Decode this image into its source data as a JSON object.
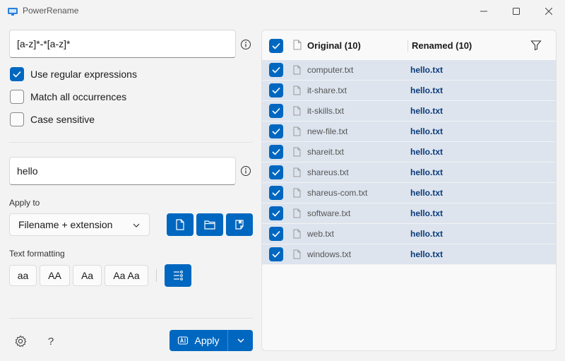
{
  "window": {
    "title": "PowerRename"
  },
  "search": {
    "value": "[a-z]*-*[a-z]*"
  },
  "options": [
    {
      "label": "Use regular expressions",
      "checked": true
    },
    {
      "label": "Match all occurrences",
      "checked": false
    },
    {
      "label": "Case sensitive",
      "checked": false
    }
  ],
  "replace": {
    "value": "hello"
  },
  "apply_to": {
    "label": "Apply to",
    "selected": "Filename + extension"
  },
  "text_formatting": {
    "label": "Text formatting",
    "buttons": [
      "aa",
      "AA",
      "Aa",
      "Aa Aa"
    ]
  },
  "apply_button": {
    "label": "Apply"
  },
  "list": {
    "header_original": "Original (10)",
    "header_renamed": "Renamed (10)",
    "rows": [
      {
        "original": "computer.txt",
        "renamed": "hello.txt"
      },
      {
        "original": "it-share.txt",
        "renamed": "hello.txt"
      },
      {
        "original": "it-skills.txt",
        "renamed": "hello.txt"
      },
      {
        "original": "new-file.txt",
        "renamed": "hello.txt"
      },
      {
        "original": "shareit.txt",
        "renamed": "hello.txt"
      },
      {
        "original": "shareus.txt",
        "renamed": "hello.txt"
      },
      {
        "original": "shareus-com.txt",
        "renamed": "hello.txt"
      },
      {
        "original": "software.txt",
        "renamed": "hello.txt"
      },
      {
        "original": "web.txt",
        "renamed": "hello.txt"
      },
      {
        "original": "windows.txt",
        "renamed": "hello.txt"
      }
    ]
  },
  "colors": {
    "accent": "#0067c0",
    "row_selected": "#dde4ee",
    "renamed_text": "#0a3a7a"
  },
  "icons": [
    "app-icon",
    "minimize-icon",
    "maximize-icon",
    "close-icon",
    "info-icon",
    "checkmark-icon",
    "chevron-down-icon",
    "file-icon",
    "folder-icon",
    "subfolder-icon",
    "list-settings-icon",
    "rename-icon",
    "filter-icon",
    "gear-icon",
    "help-icon"
  ]
}
